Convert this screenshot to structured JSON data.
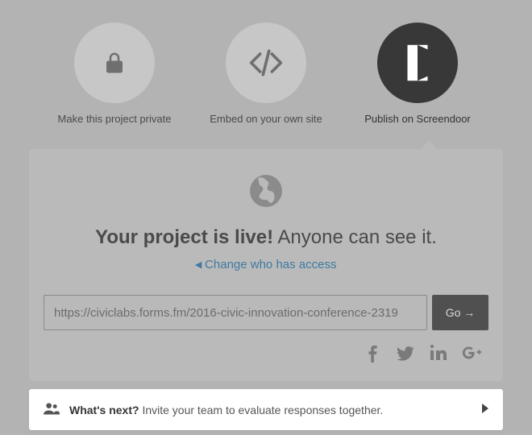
{
  "options": {
    "private": {
      "label": "Make this project private"
    },
    "embed": {
      "label": "Embed on your own site"
    },
    "publish": {
      "label": "Publish on Screendoor"
    }
  },
  "live": {
    "bold": "Your project is live!",
    "rest": "Anyone can see it.",
    "change": "Change who has access",
    "url": "https://civiclabs.forms.fm/2016-civic-innovation-conference-2319",
    "go": "Go →"
  },
  "footer": {
    "strong": "What's next?",
    "rest": "Invite your team to evaluate responses together."
  }
}
